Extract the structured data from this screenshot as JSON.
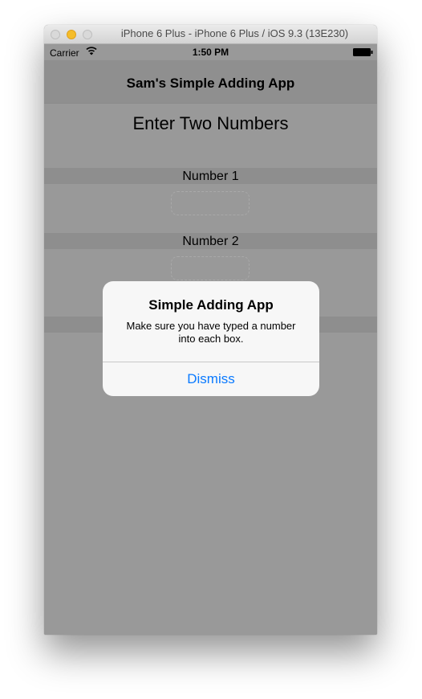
{
  "window": {
    "title": "iPhone 6 Plus - iPhone 6 Plus / iOS 9.3 (13E230)"
  },
  "status_bar": {
    "carrier": "Carrier",
    "time": "1:50 PM"
  },
  "nav": {
    "title": "Sam's Simple Adding App"
  },
  "main": {
    "heading": "Enter Two Numbers",
    "number1_label": "Number 1",
    "number1_value": "",
    "number2_label": "Number 2",
    "number2_value": ""
  },
  "alert": {
    "title": "Simple Adding App",
    "message": "Make sure you have typed a number into each box.",
    "dismiss_label": "Dismiss"
  },
  "colors": {
    "accent": "#0a7aff",
    "dimmed_background": "#999999",
    "alert_background": "#f7f7f7"
  }
}
